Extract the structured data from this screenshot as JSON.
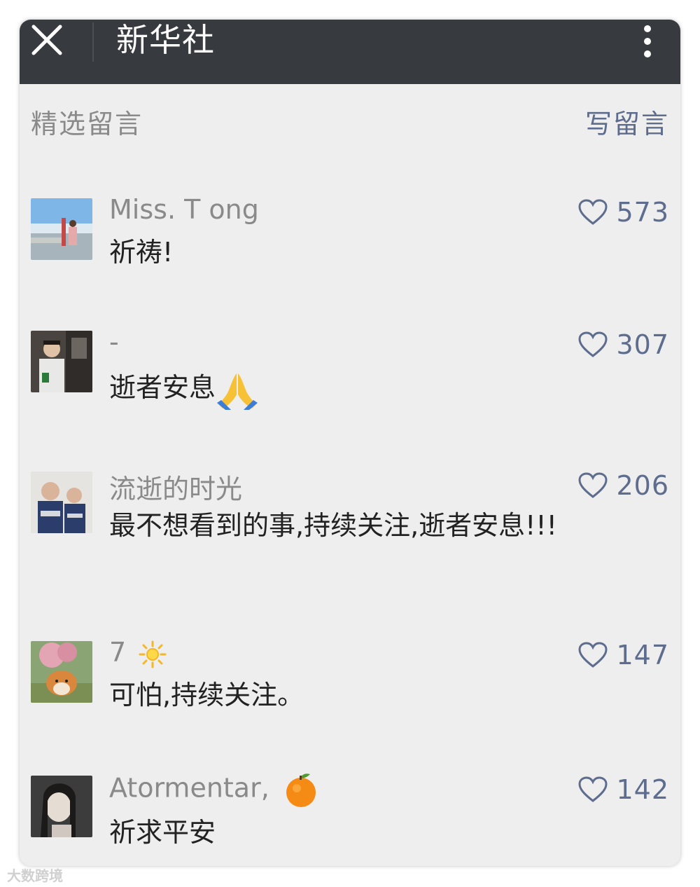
{
  "titlebar": {
    "title": "新华社"
  },
  "section": {
    "label": "精选留言",
    "write_label": "写留言"
  },
  "comments": [
    {
      "nick": "Miss. T ong",
      "text": "祈祷!",
      "likes": "573"
    },
    {
      "nick": "-",
      "text": "逝者安息",
      "likes": "307"
    },
    {
      "nick": "流逝的时光",
      "text": "最不想看到的事,持续关注,逝者安息!!!",
      "likes": "206"
    },
    {
      "nick": "7",
      "text": "可怕,持续关注。",
      "likes": "147"
    },
    {
      "nick": "Atormentar,",
      "text": "祈求平安",
      "likes": "142"
    }
  ],
  "watermark": "大数跨境",
  "colors": {
    "titlebar": "#373a3e",
    "background": "#eeeeee",
    "link": "#5e6d8e",
    "nick": "#8a8a8a"
  },
  "icons": [
    "close-icon",
    "more-vertical-icon",
    "heart-icon",
    "praying-hands-emoji",
    "sun-emoji",
    "tangerine-emoji"
  ]
}
